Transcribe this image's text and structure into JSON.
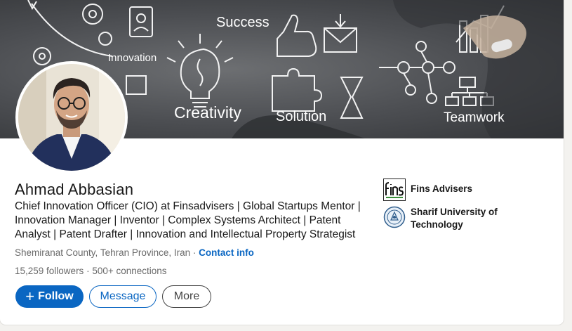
{
  "banner": {
    "words": {
      "success": "Success",
      "innovation": "Innovation",
      "creativity": "Creativity",
      "solution": "Solution",
      "teamwork": "Teamwork"
    }
  },
  "profile": {
    "name": "Ahmad Abbasian",
    "headline": "Chief Innovation Officer (CIO) at Finsadvisers | Global Startups Mentor | Innovation Manager | Inventor | Complex Systems Architect | Patent Analyst | Patent Drafter | Innovation and Intellectual Property Strategist",
    "location": "Shemiranat County, Tehran Province, Iran",
    "location_separator": " · ",
    "contact_info": "Contact info",
    "followers": "15,259 followers",
    "stats_separator": " · ",
    "connections": "500+ connections"
  },
  "actions": {
    "follow_icon": "+",
    "follow": "Follow",
    "message": "Message",
    "more": "More"
  },
  "experience": [
    {
      "name": "Fins Advisers",
      "logo": "fins-logo"
    },
    {
      "name": "Sharif University of Technology",
      "logo": "sharif-university-seal"
    }
  ],
  "colors": {
    "primary": "#0a66c2",
    "text_muted": "rgba(0,0,0,0.6)",
    "banner_bg": "#4c4e52"
  }
}
